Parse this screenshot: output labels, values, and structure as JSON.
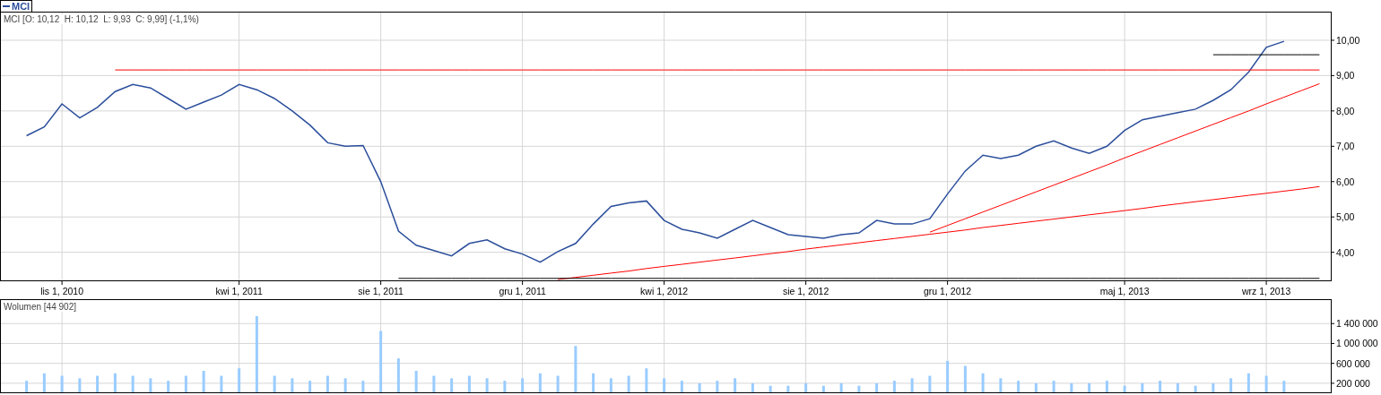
{
  "price_panel": {
    "title": "MCI [O: 10,12  H: 10,12  L: 9,93  C: 9,99] (-1,1%)",
    "chart_data": {
      "type": "line",
      "categories": [
        null,
        null,
        "lis 1, 2010",
        null,
        null,
        null,
        null,
        null,
        null,
        null,
        null,
        null,
        "kwi 1, 2011",
        null,
        null,
        null,
        null,
        null,
        null,
        null,
        "sie 1, 2011",
        null,
        null,
        null,
        null,
        null,
        null,
        null,
        "gru 1, 2011",
        null,
        null,
        null,
        null,
        null,
        null,
        null,
        "kwi 1, 2012",
        null,
        null,
        null,
        null,
        null,
        null,
        null,
        "sie 1, 2012",
        null,
        null,
        null,
        null,
        null,
        null,
        null,
        "gru 1, 2012",
        null,
        null,
        null,
        null,
        null,
        null,
        null,
        null,
        null,
        "maj 1, 2013",
        null,
        null,
        null,
        null,
        null,
        null,
        null,
        "wrz 1, 2013",
        null,
        null,
        null
      ],
      "series": [
        {
          "name": "MCI",
          "color": "#2b4e9b",
          "values": [
            7.3,
            7.55,
            8.2,
            7.8,
            8.1,
            8.55,
            8.75,
            8.65,
            8.35,
            8.05,
            8.25,
            8.45,
            8.75,
            8.6,
            8.35,
            8.0,
            7.6,
            7.1,
            7.0,
            7.02,
            6.0,
            4.6,
            4.2,
            4.05,
            3.9,
            4.25,
            4.35,
            4.1,
            3.95,
            3.72,
            4.02,
            4.25,
            4.8,
            5.3,
            5.4,
            5.45,
            4.9,
            4.65,
            4.55,
            4.4,
            4.65,
            4.9,
            4.7,
            4.5,
            4.45,
            4.4,
            4.5,
            4.55,
            4.9,
            4.8,
            4.8,
            4.95,
            5.65,
            6.3,
            6.75,
            6.65,
            6.75,
            7.0,
            7.15,
            6.95,
            6.8,
            7.0,
            7.45,
            7.75,
            7.85,
            7.95,
            8.05,
            8.3,
            8.6,
            9.1,
            9.8,
            9.97,
            null,
            null
          ]
        },
        {
          "color": "#ff0000",
          "values": [
            null,
            null,
            null,
            null,
            null,
            9.16,
            9.16,
            9.16,
            9.16,
            9.16,
            9.16,
            9.16,
            9.16,
            9.16,
            9.16,
            9.16,
            9.16,
            9.16,
            9.16,
            9.16,
            9.16,
            9.16,
            9.16,
            9.16,
            9.16,
            9.16,
            9.16,
            9.16,
            9.16,
            9.16,
            9.16,
            9.16,
            9.16,
            9.16,
            9.16,
            9.16,
            9.16,
            9.16,
            9.16,
            9.16,
            9.16,
            9.16,
            9.16,
            9.16,
            9.16,
            9.16,
            9.16,
            9.16,
            9.16,
            9.16,
            9.16,
            9.16,
            9.16,
            9.16,
            9.16,
            9.16,
            9.16,
            9.16,
            9.16,
            9.16,
            9.16,
            9.16,
            9.16,
            9.16,
            9.16,
            9.16,
            9.16,
            9.16,
            9.16,
            9.16,
            9.16,
            9.16,
            9.16,
            9.16
          ]
        },
        {
          "color": "#ff0000",
          "values": [
            null,
            null,
            null,
            null,
            null,
            null,
            null,
            null,
            null,
            null,
            null,
            null,
            null,
            null,
            null,
            null,
            null,
            null,
            null,
            null,
            null,
            null,
            null,
            null,
            null,
            null,
            null,
            null,
            null,
            null,
            3.23,
            3.29,
            3.35,
            3.41,
            3.47,
            3.54,
            3.6,
            3.66,
            3.72,
            3.78,
            3.84,
            3.9,
            3.96,
            4.02,
            4.09,
            4.15,
            4.21,
            4.27,
            4.33,
            4.39,
            4.45,
            4.51,
            4.57,
            4.63,
            4.7,
            4.76,
            4.82,
            4.88,
            4.94,
            5.0,
            5.06,
            5.12,
            5.18,
            5.24,
            5.31,
            5.37,
            5.43,
            5.49,
            5.55,
            5.61,
            5.67,
            5.73,
            5.79,
            5.86
          ]
        },
        {
          "color": "#ff0000",
          "values": [
            null,
            null,
            null,
            null,
            null,
            null,
            null,
            null,
            null,
            null,
            null,
            null,
            null,
            null,
            null,
            null,
            null,
            null,
            null,
            null,
            null,
            null,
            null,
            null,
            null,
            null,
            null,
            null,
            null,
            null,
            null,
            null,
            null,
            null,
            null,
            null,
            null,
            null,
            null,
            null,
            null,
            null,
            null,
            null,
            null,
            null,
            null,
            null,
            null,
            null,
            null,
            4.57,
            4.76,
            4.95,
            5.14,
            5.33,
            5.52,
            5.71,
            5.9,
            6.09,
            6.28,
            6.47,
            6.67,
            6.86,
            7.05,
            7.24,
            7.43,
            7.62,
            7.81,
            8.0,
            8.2,
            8.39,
            8.58,
            8.77
          ]
        },
        {
          "color": "#000000",
          "values": [
            null,
            null,
            null,
            null,
            null,
            null,
            null,
            null,
            null,
            null,
            null,
            null,
            null,
            null,
            null,
            null,
            null,
            null,
            null,
            null,
            null,
            3.26,
            3.26,
            3.26,
            3.26,
            3.26,
            3.26,
            3.26,
            3.26,
            3.26,
            3.26,
            3.26,
            3.26,
            3.26,
            3.26,
            3.26,
            3.26,
            3.26,
            3.26,
            3.26,
            3.26,
            3.26,
            3.26,
            3.26,
            3.26,
            3.26,
            3.26,
            3.26,
            3.26,
            3.26,
            3.26,
            3.26,
            3.26,
            3.26,
            3.26,
            3.26,
            3.26,
            3.26,
            3.26,
            3.26,
            3.26,
            3.26,
            3.26,
            3.26,
            3.26,
            3.26,
            3.26,
            3.26,
            3.26,
            3.26,
            3.26,
            3.26,
            3.26,
            3.26
          ]
        },
        {
          "color": "#000000",
          "values": [
            null,
            null,
            null,
            null,
            null,
            null,
            null,
            null,
            null,
            null,
            null,
            null,
            null,
            null,
            null,
            null,
            null,
            null,
            null,
            null,
            null,
            null,
            null,
            null,
            null,
            null,
            null,
            null,
            null,
            null,
            null,
            null,
            null,
            null,
            null,
            null,
            null,
            null,
            null,
            null,
            null,
            null,
            null,
            null,
            null,
            null,
            null,
            null,
            null,
            null,
            null,
            null,
            null,
            null,
            null,
            null,
            null,
            null,
            null,
            null,
            null,
            null,
            null,
            null,
            null,
            null,
            null,
            9.59,
            9.59,
            9.59,
            9.59,
            9.59,
            9.59,
            9.59
          ]
        }
      ],
      "ylim": [
        3.18,
        10.81
      ],
      "grid": true,
      "yticks": [
        {
          "value": 4,
          "label": "4,00"
        },
        {
          "value": 5,
          "label": "5,00"
        },
        {
          "value": 6,
          "label": "6,00"
        },
        {
          "value": 7,
          "label": "7,00"
        },
        {
          "value": 8,
          "label": "8,00"
        },
        {
          "value": 9,
          "label": "9,00"
        },
        {
          "value": 10,
          "label": "10,00"
        }
      ]
    }
  },
  "volume_panel": {
    "title": "Wolumen [44 902]",
    "chart_data": {
      "type": "bar",
      "series": [
        {
          "color": "#99ccff",
          "values": [
            250000,
            400000,
            350000,
            300000,
            350000,
            400000,
            350000,
            300000,
            250000,
            350000,
            450000,
            350000,
            500000,
            1550000,
            350000,
            300000,
            250000,
            350000,
            300000,
            250000,
            1250000,
            700000,
            450000,
            350000,
            300000,
            350000,
            300000,
            250000,
            300000,
            400000,
            350000,
            950000,
            400000,
            300000,
            350000,
            500000,
            300000,
            250000,
            200000,
            250000,
            300000,
            200000,
            150000,
            150000,
            200000,
            150000,
            200000,
            150000,
            200000,
            250000,
            300000,
            350000,
            650000,
            550000,
            400000,
            300000,
            250000,
            200000,
            250000,
            200000,
            200000,
            250000,
            150000,
            200000,
            250000,
            200000,
            150000,
            200000,
            300000,
            400000,
            350000,
            250000
          ]
        }
      ],
      "ylim": [
        0,
        1890000
      ],
      "grid": true,
      "yticks": [
        {
          "value": 200000,
          "label": "200 000"
        },
        {
          "value": 600000,
          "label": "600 000"
        },
        {
          "value": 1000000,
          "label": "1 000 000"
        },
        {
          "value": 1400000,
          "label": "1 400 000"
        }
      ]
    }
  }
}
